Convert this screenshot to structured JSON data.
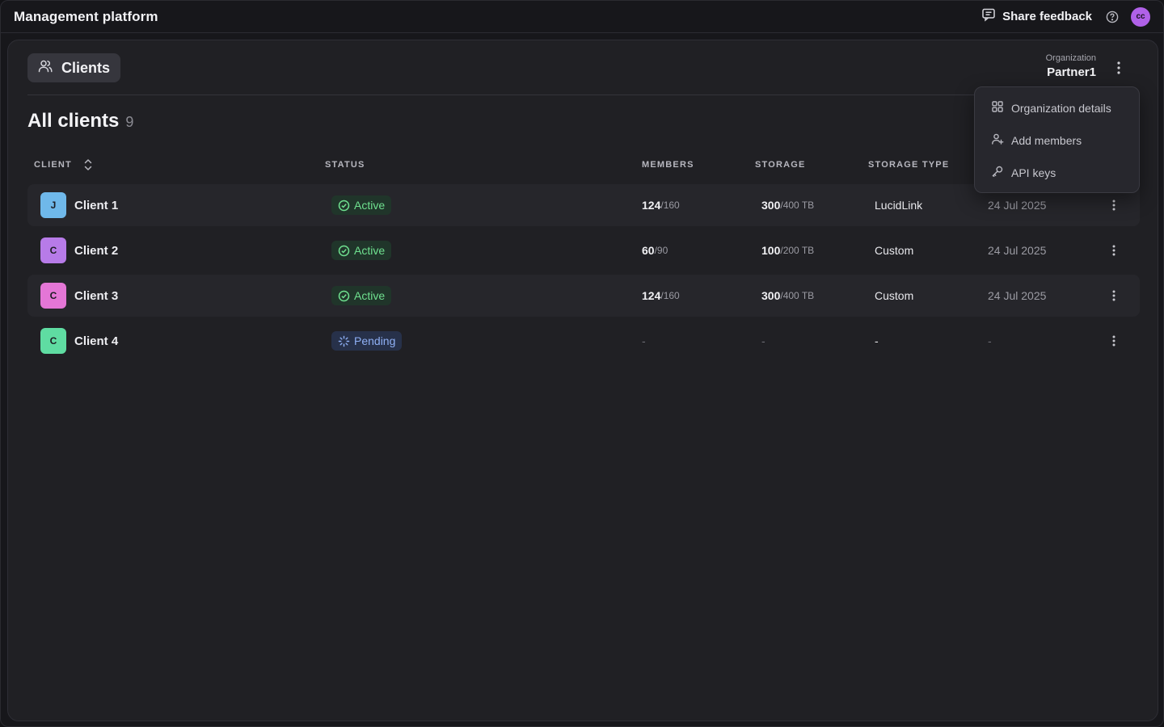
{
  "app": {
    "title": "Management platform",
    "share_feedback": "Share feedback",
    "avatar_initials": "cc",
    "avatar_color": "#b061e8"
  },
  "header": {
    "tab_label": "Clients",
    "org_label": "Organization",
    "org_name": "Partner1"
  },
  "section": {
    "title": "All clients",
    "count": "9"
  },
  "table": {
    "columns": {
      "client": "CLIENT",
      "status": "STATUS",
      "members": "MEMBERS",
      "storage": "STORAGE",
      "storage_type": "STORAGE TYPE"
    },
    "rows": [
      {
        "initial": "J",
        "initial_color": "#6fb8ea",
        "name": "Client 1",
        "status": "Active",
        "status_kind": "active",
        "members_used": "124",
        "members_total": "/160",
        "storage_used": "300",
        "storage_total": "/400 TB",
        "storage_type": "LucidLink",
        "date": "24 Jul 2025"
      },
      {
        "initial": "C",
        "initial_color": "#b77be8",
        "name": "Client 2",
        "status": "Active",
        "status_kind": "active",
        "members_used": "60",
        "members_total": "/90",
        "storage_used": "100",
        "storage_total": "/200 TB",
        "storage_type": "Custom",
        "date": "24 Jul 2025"
      },
      {
        "initial": "C",
        "initial_color": "#e476d6",
        "name": "Client 3",
        "status": "Active",
        "status_kind": "active",
        "members_used": "124",
        "members_total": "/160",
        "storage_used": "300",
        "storage_total": "/400 TB",
        "storage_type": "Custom",
        "date": "24 Jul 2025"
      },
      {
        "initial": "C",
        "initial_color": "#5fdca2",
        "name": "Client 4",
        "status": "Pending",
        "status_kind": "pending",
        "members_dash": "-",
        "storage_dash": "-",
        "storage_type_dash": "-",
        "date_dash": "-"
      }
    ]
  },
  "org_menu": {
    "items": [
      {
        "label": "Organization details",
        "icon": "grid-icon"
      },
      {
        "label": "Add members",
        "icon": "user-plus-icon"
      },
      {
        "label": "API keys",
        "icon": "key-icon"
      }
    ]
  },
  "colors": {
    "active_text": "#6fe08f",
    "pending_text": "#8fb0f5"
  }
}
